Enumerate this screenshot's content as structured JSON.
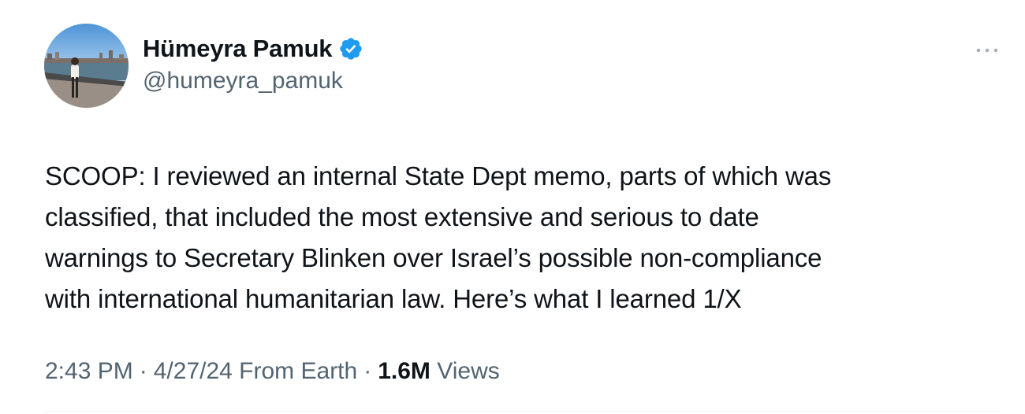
{
  "author": {
    "display_name": "Hümeyra Pamuk",
    "handle": "@humeyra_pamuk",
    "verified": true
  },
  "tweet": {
    "text": "SCOOP: I reviewed an internal State Dept memo, parts of which was\nclassified, that included the most extensive and serious to date\nwarnings to Secretary Blinken over Israel’s possible non-compliance\nwith international humanitarian law. Here’s what I learned 1/X"
  },
  "meta": {
    "time": "2:43 PM",
    "separator": "·",
    "date": "4/27/24",
    "source": "From Earth",
    "views_count": "1.6M",
    "views_label": "Views"
  },
  "colors": {
    "text": "#0f1419",
    "secondary": "#536471",
    "verified_blue": "#1d9bf0",
    "divider": "#eff3f4"
  },
  "icons": {
    "verified": "verified-badge-icon",
    "more": "more-dots-icon"
  }
}
